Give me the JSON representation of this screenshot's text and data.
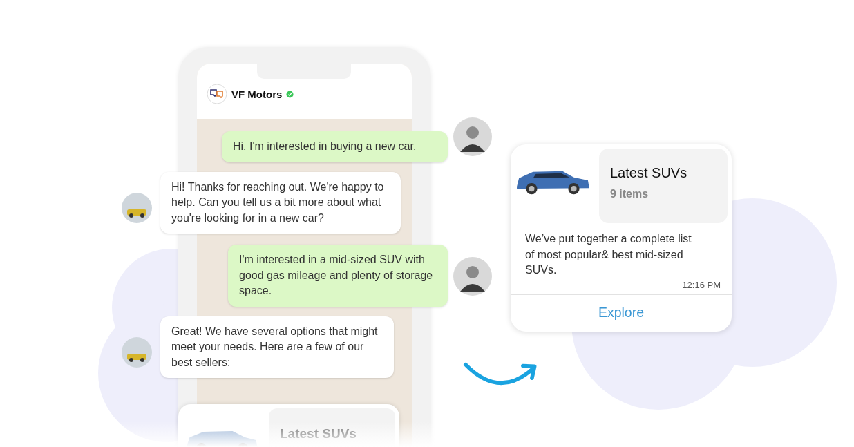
{
  "chat": {
    "business_name": "VF Motors",
    "verified": true
  },
  "messages": [
    {
      "kind": "sent",
      "text": "Hi, I'm interested in buying a new car."
    },
    {
      "kind": "received",
      "text": "Hi! Thanks for reaching out. We're happy to help. Can you tell us a bit more about what you're looking for in a new car?"
    },
    {
      "kind": "sent",
      "text": "I'm interested in a mid-sized SUV with good gas mileage and plenty of storage space."
    },
    {
      "kind": "received",
      "text": "Great! We have several options that might meet your needs. Here are a few of our best sellers:"
    }
  ],
  "preview_card": {
    "title": "Latest SUVs"
  },
  "product_card": {
    "title": "Latest SUVs",
    "count": "9 items",
    "description": "We’ve put together a complete list of most popular& best mid-sized SUVs.",
    "time": "12:16 PM",
    "action": "Explore"
  }
}
